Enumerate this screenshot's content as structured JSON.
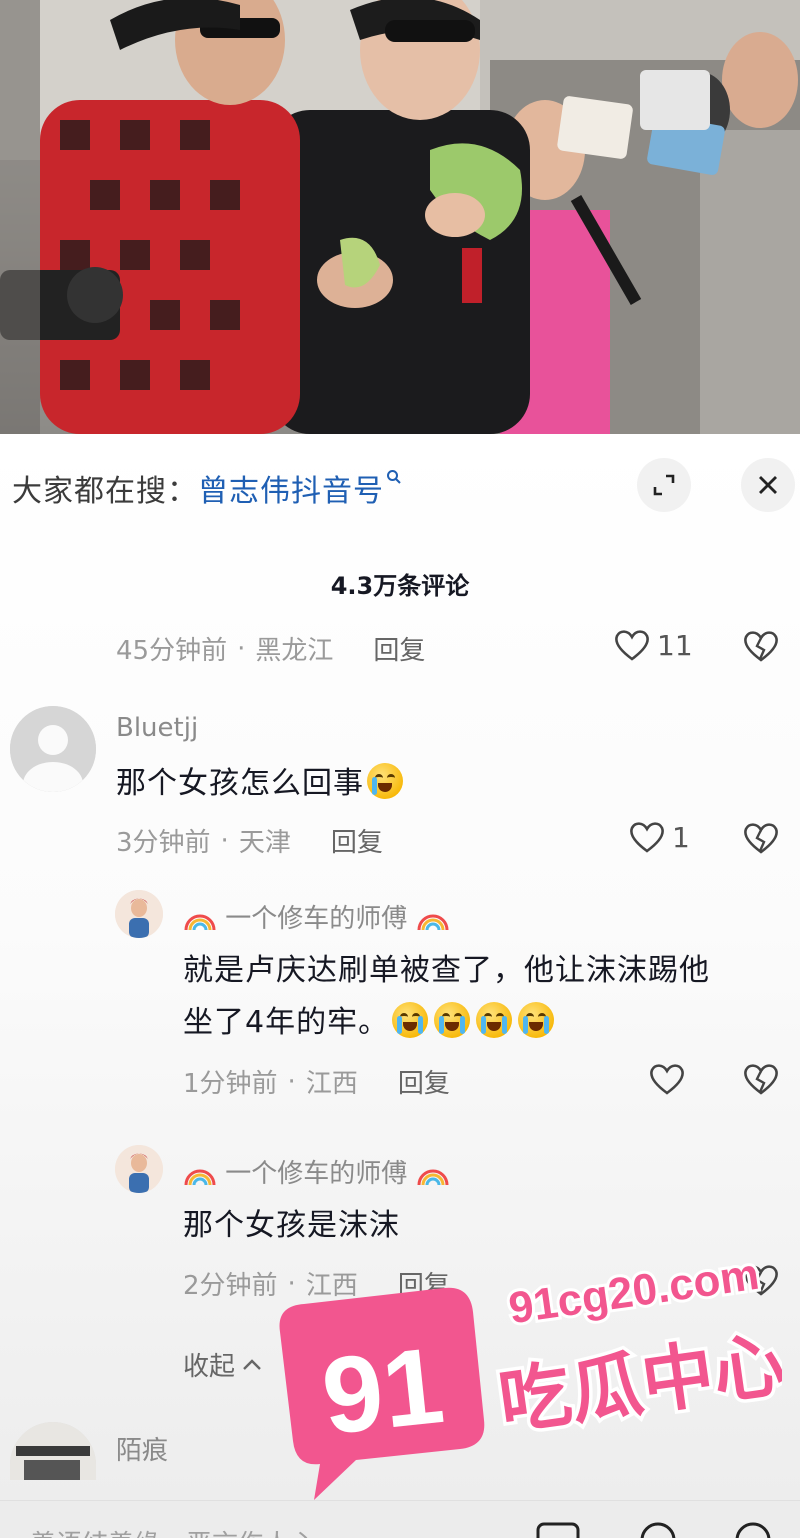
{
  "search": {
    "prefix": "大家都在搜：",
    "term": "曾志伟抖音号"
  },
  "comments_header": {
    "count_title": "4.3万条评论"
  },
  "comments": [
    {
      "time": "45分钟前",
      "location": "黑龙江",
      "reply_label": "回复",
      "likes": "11"
    },
    {
      "username": "Bluetjj",
      "text": "那个女孩怎么回事",
      "emoji": "rofl-emoji",
      "time": "3分钟前",
      "location": "天津",
      "reply_label": "回复",
      "likes": "1"
    }
  ],
  "replies": [
    {
      "username": "一个修车的师傅",
      "text_line1": "就是卢庆达刷单被查了，他让沫沫踢他",
      "text_line2": "坐了4年的牢。",
      "emoji": "crying-emoji",
      "time": "1分钟前",
      "location": "江西",
      "reply_label": "回复"
    },
    {
      "username": "一个修车的师傅",
      "text": "那个女孩是沫沫",
      "time": "2分钟前",
      "location": "江西",
      "reply_label": "回复"
    }
  ],
  "collapse_label": "收起",
  "next_comment": {
    "username": "陌痕"
  },
  "bottom_bar": {
    "placeholder": "善语结善缘，恶言伤人心"
  },
  "watermark": {
    "site": "91cg20.com",
    "badge": "91",
    "title": "吃瓜中心"
  },
  "colors": {
    "link_blue": "#1f5fb3",
    "watermark_pink": "#f2568f"
  }
}
